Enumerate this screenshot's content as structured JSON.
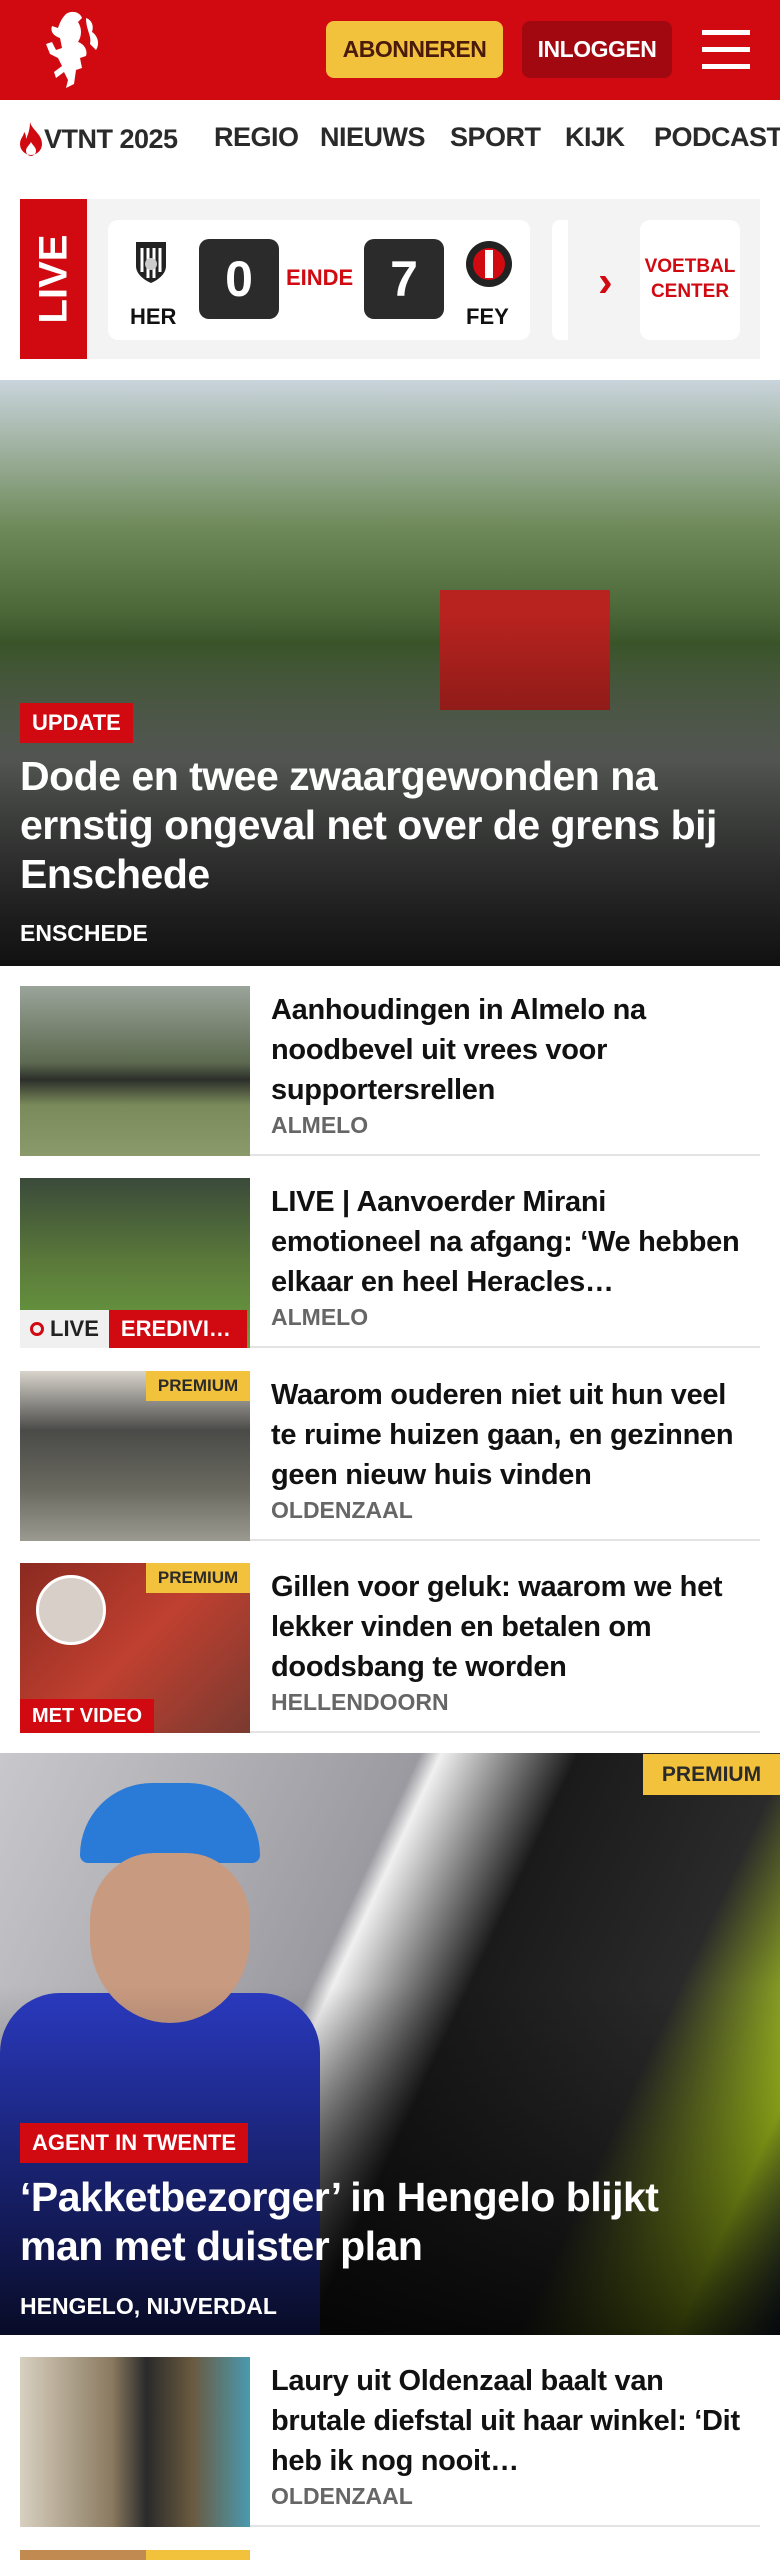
{
  "header": {
    "abonneren": "ABONNEREN",
    "inloggen": "INLOGGEN"
  },
  "nav": {
    "items": [
      "VTNT 2025",
      "REGIO",
      "NIEUWS",
      "SPORT",
      "KIJK",
      "PODCAST"
    ]
  },
  "live": {
    "label": "LIVE",
    "home": "HER",
    "home_score": "0",
    "status": "EINDE",
    "away_score": "7",
    "away": "FEY",
    "voetbal_center": "VOETBAL CENTER"
  },
  "hero": {
    "tag": "UPDATE",
    "title": "Dode en twee zwaargewonden na ernstig ongeval net over de grens bij Enschede",
    "location": "ENSCHEDE"
  },
  "items": [
    {
      "title": "Aanhoudingen in Almelo na noodbevel uit vrees voor supportersrellen",
      "location": "ALMELO"
    },
    {
      "title": "LIVE | Aanvoerder Mirani emotioneel na afgang: ‘We hebben elkaar en heel Heracles…",
      "location": "ALMELO",
      "live": "LIVE",
      "category": "EREDIVI…"
    },
    {
      "title": "Waarom ouderen niet uit hun veel te ruime huizen gaan, en gezinnen geen nieuw huis vinden",
      "location": "OLDENZAAL",
      "premium": "PREMIUM"
    },
    {
      "title": "Gillen voor geluk: waarom we het lekker vinden en betalen om doodsbang te worden",
      "location": "HELLENDOORN",
      "premium": "PREMIUM",
      "video": "MET VIDEO"
    }
  ],
  "feature": {
    "premium": "PREMIUM",
    "tag": "AGENT IN TWENTE",
    "title": "‘Pakketbezorger’ in Hengelo blijkt man met duister plan",
    "location": "HENGELO, NIJVERDAL"
  },
  "items2": [
    {
      "title": "Laury uit Oldenzaal baalt van brutale diefstal uit haar winkel: ‘Dit heb ik nog nooit…",
      "location": "OLDENZAAL"
    }
  ],
  "colors": {
    "brand": "#d10a11",
    "premium": "#f2c23c"
  }
}
